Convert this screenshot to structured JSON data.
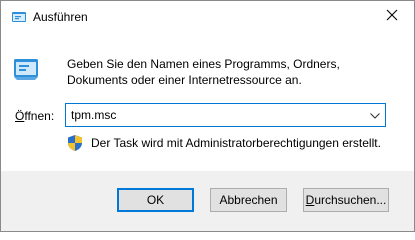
{
  "window": {
    "title": "Ausführen",
    "close_icon": "close-icon"
  },
  "main": {
    "description_line1": "Geben Sie den Namen eines Programms, Ordners,",
    "description_line2": "Dokuments oder einer Internetressource an.",
    "open_label_mnemonic": "Ö",
    "open_label_rest": "ffnen:",
    "input_value": "tpm.msc",
    "admin_notice": "Der Task wird mit Administratorberechtigungen erstellt."
  },
  "buttons": {
    "ok": "OK",
    "cancel": "Abbrechen",
    "browse_mnemonic": "D",
    "browse_rest": "urchsuchen..."
  },
  "colors": {
    "accent": "#0078d7",
    "footer_bg": "#f0f0f0",
    "button_bg": "#e1e1e1"
  }
}
